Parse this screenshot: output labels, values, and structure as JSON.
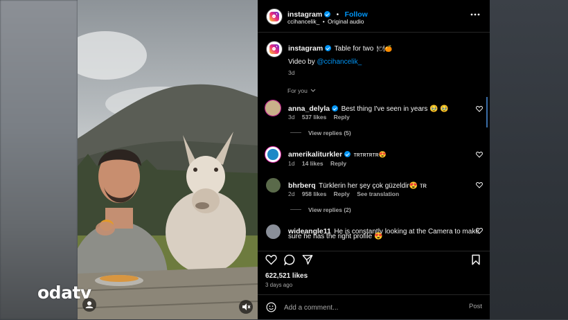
{
  "watermark": {
    "text": "odatv"
  },
  "header": {
    "username": "instagram",
    "separator": "•",
    "follow_label": "Follow",
    "subtitle_user": "ccihancelik_",
    "subtitle_sep": "•",
    "subtitle_audio": "Original audio",
    "more_icon": "more-horizontal-icon"
  },
  "caption": {
    "username": "instagram",
    "text": "Table for two",
    "emoji": "🍽🍊",
    "credit_prefix": "Video by",
    "credit_handle": "@ccihancelik_",
    "time": "3d"
  },
  "sort_label": "For you",
  "comments": [
    {
      "username": "anna_delyla",
      "verified": true,
      "text": "Best thing I've seen in years 🥹 🥹",
      "time": "3d",
      "likes": "537 likes",
      "reply": "Reply",
      "view_replies": "View replies (5)",
      "avatar_color": "#c9b08a"
    },
    {
      "username": "amerikaliturkler",
      "verified": true,
      "text": "ᴛʀᴛʀᴛʀᴛʀ😍",
      "time": "1d",
      "likes": "14 likes",
      "reply": "Reply",
      "avatar_color": "#1e88c7"
    },
    {
      "username": "bhrberq",
      "verified": false,
      "text": "Türklerin her şey çok güzeldir😍 ᴛʀ",
      "time": "2d",
      "likes": "958 likes",
      "reply": "Reply",
      "translate": "See translation",
      "view_replies": "View replies (2)",
      "avatar_color": "#5a6a4a"
    },
    {
      "username": "wideangle11",
      "verified": false,
      "text_line1": "He is constantly looking at the Camera to make",
      "text_line2": "sure he has the right profile 😍",
      "avatar_color": "#8a8f99"
    }
  ],
  "likes_count": "622,521 likes",
  "posted": "3 days ago",
  "comment_input": {
    "placeholder": "Add a comment...",
    "post_label": "Post"
  },
  "colors": {
    "accent": "#0095f6",
    "panel_bg": "#000000"
  }
}
